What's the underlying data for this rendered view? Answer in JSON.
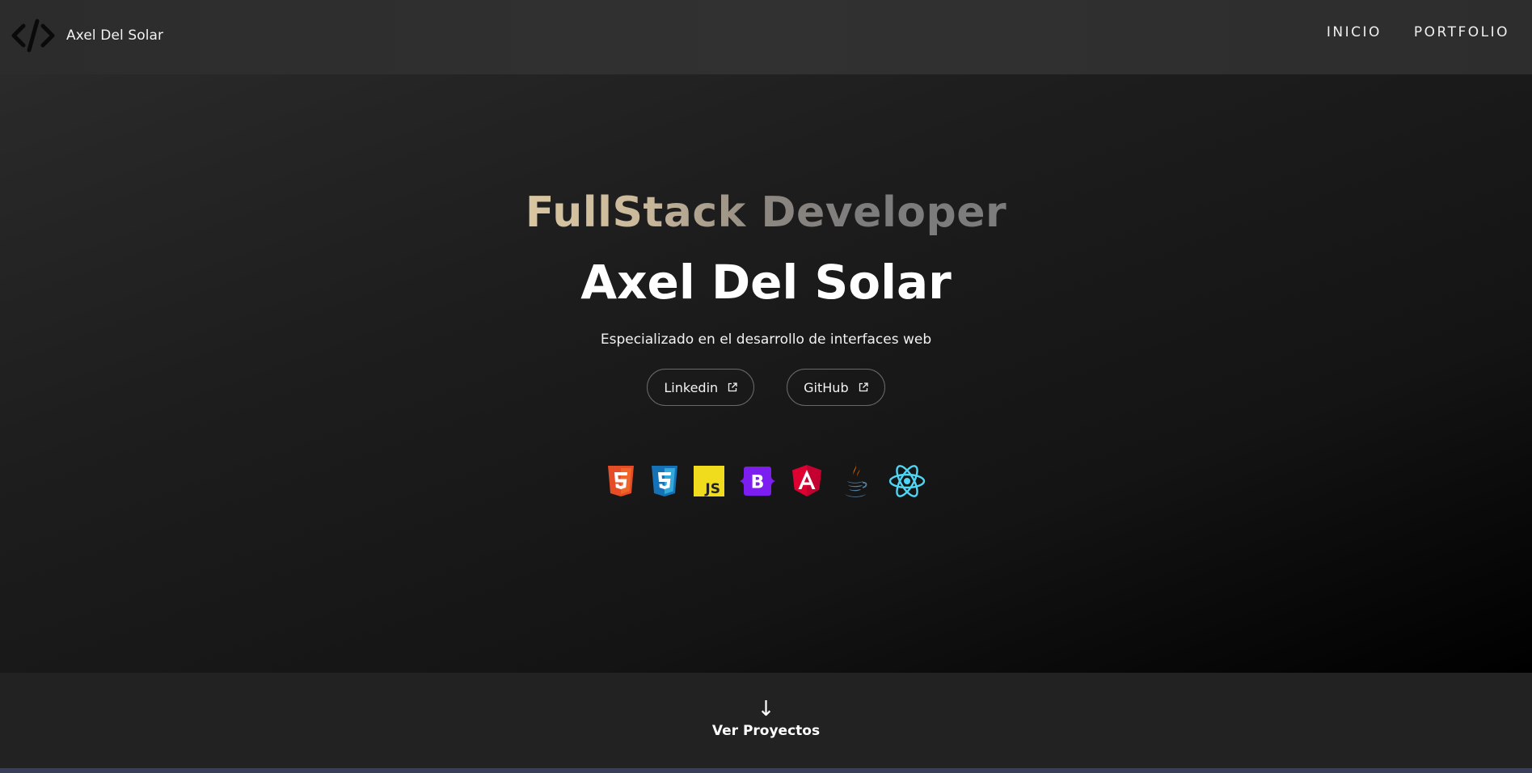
{
  "header": {
    "brand_name": "Axel Del Solar",
    "logo_icon": "code-brackets-icon",
    "nav": [
      {
        "label": "INICIO"
      },
      {
        "label": "PORTFOLIO"
      }
    ]
  },
  "hero": {
    "role": "FullStack Developer",
    "name": "Axel Del Solar",
    "tagline": "Especializado en el desarrollo de interfaces web",
    "buttons": [
      {
        "label": "Linkedin",
        "icon": "external-link-icon"
      },
      {
        "label": "GitHub",
        "icon": "external-link-icon"
      }
    ],
    "tech_icons": [
      {
        "name": "html5-icon",
        "color": "#e44d26"
      },
      {
        "name": "css3-icon",
        "color": "#1f8ee0"
      },
      {
        "name": "javascript-icon",
        "color": "#f0db1c"
      },
      {
        "name": "bootstrap-icon",
        "color": "#7c1ef0"
      },
      {
        "name": "angular-icon",
        "color": "#dd0031"
      },
      {
        "name": "java-icon",
        "color": "#e76f00"
      },
      {
        "name": "react-icon",
        "color": "#4fd6f5"
      }
    ]
  },
  "footer": {
    "arrow": "↓",
    "cta_label": "Ver Proyectos"
  },
  "colors": {
    "header_bg": "#2f2f2f",
    "hero_bg_start": "#2a2a2a",
    "hero_bg_end": "#000000",
    "accent_gold": "#d9c6a1",
    "accent_gray": "#7c7c7c"
  }
}
